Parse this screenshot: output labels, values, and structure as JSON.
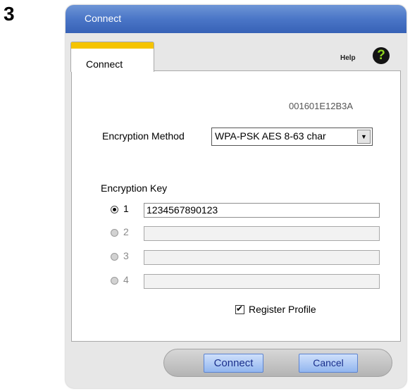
{
  "step_number": "3",
  "window": {
    "title": "Connect"
  },
  "tab": {
    "label": "Connect"
  },
  "help": {
    "label": "Help",
    "icon": "question-mark-icon",
    "icon_glyph": "?"
  },
  "mac_address": "001601E12B3A",
  "encryption_method": {
    "label": "Encryption Method",
    "selected": "WPA-PSK AES 8-63 char",
    "arrow_glyph": "▼"
  },
  "encryption_key": {
    "label": "Encryption Key",
    "keys": [
      {
        "number": "1",
        "value": "1234567890123",
        "selected": true,
        "enabled": true
      },
      {
        "number": "2",
        "value": "",
        "selected": false,
        "enabled": false
      },
      {
        "number": "3",
        "value": "",
        "selected": false,
        "enabled": false
      },
      {
        "number": "4",
        "value": "",
        "selected": false,
        "enabled": false
      }
    ]
  },
  "register_profile": {
    "label": "Register Profile",
    "checked": true,
    "check_glyph": "✔"
  },
  "buttons": {
    "connect": "Connect",
    "cancel": "Cancel"
  },
  "colors": {
    "titlebar": "#4a76c7",
    "tab_accent": "#f5c400",
    "button_text": "#1a2f8c",
    "help_icon_glyph": "#8ed41f"
  }
}
